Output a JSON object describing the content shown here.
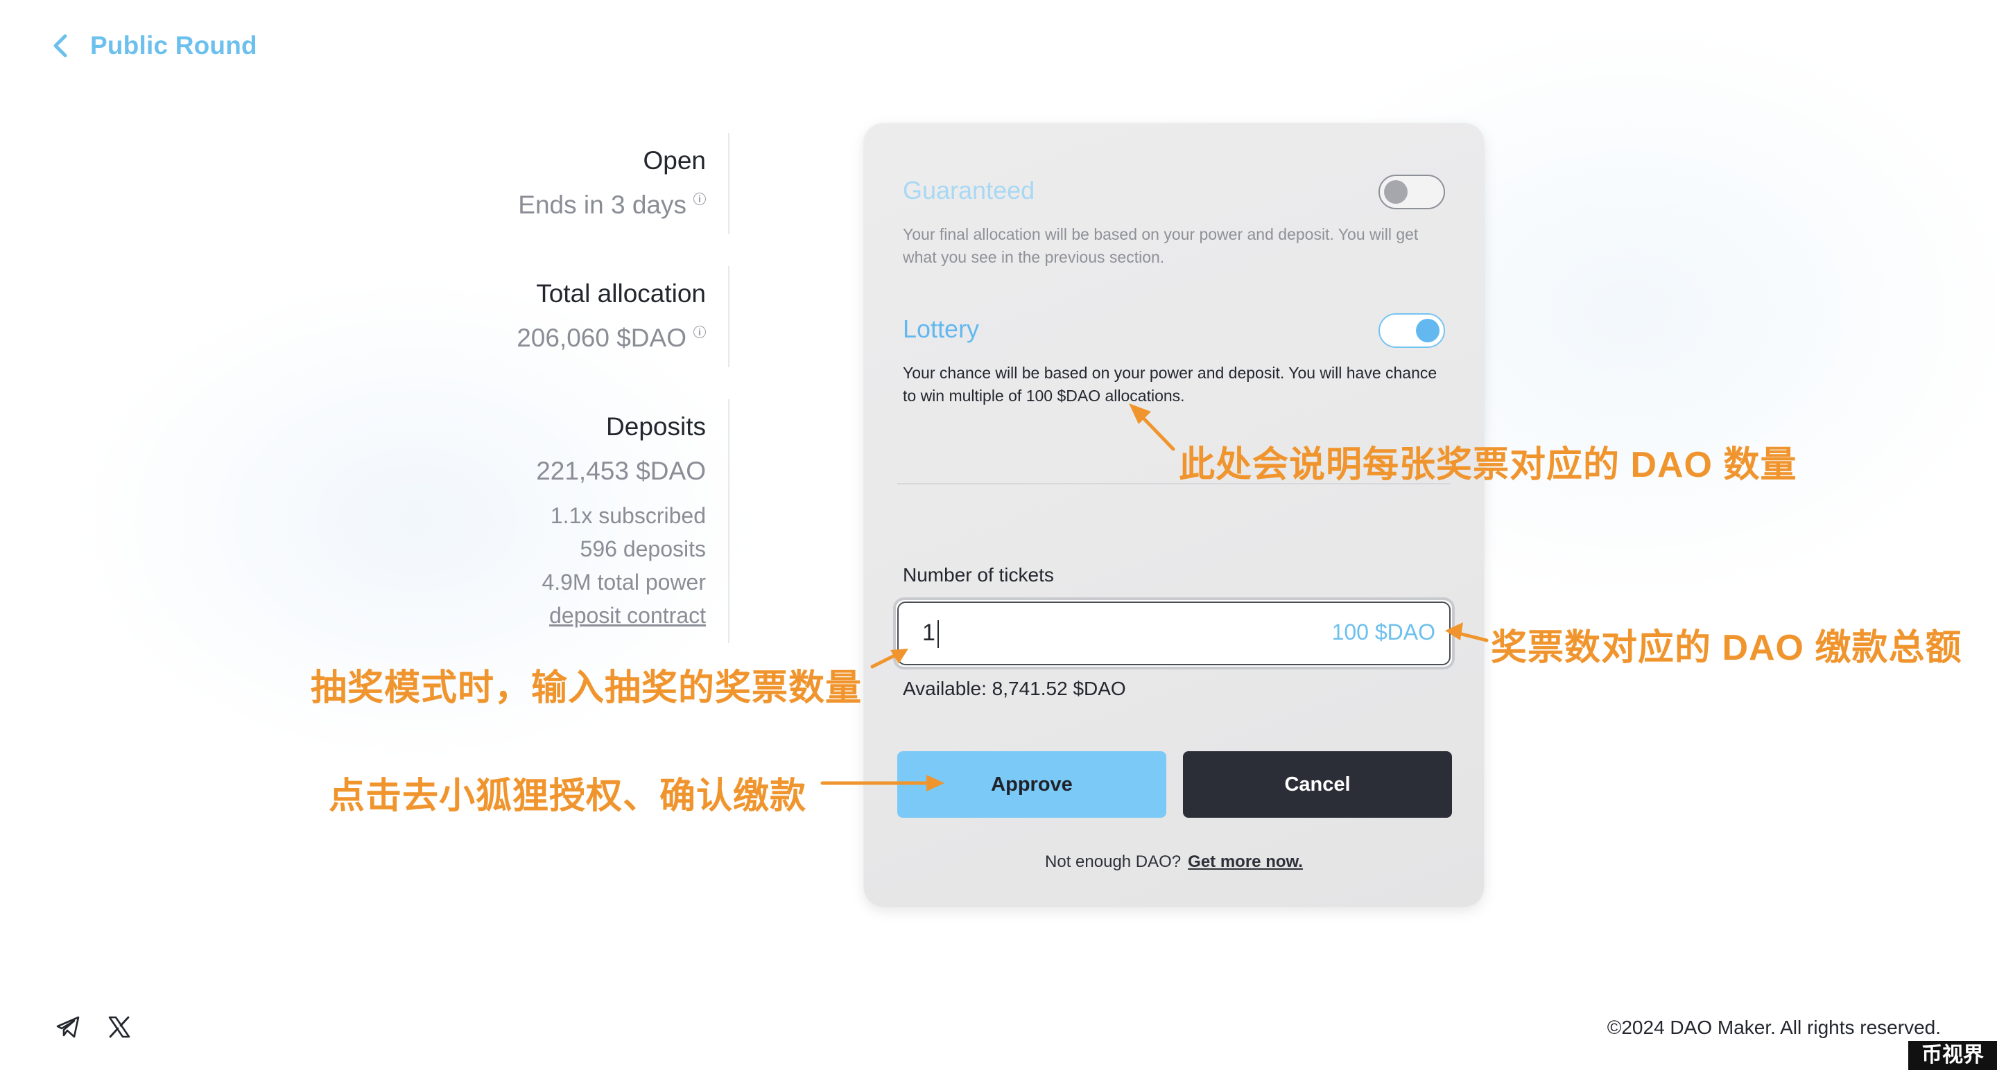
{
  "header": {
    "back_icon": "chevron-left-icon",
    "title": "Public Round"
  },
  "info": {
    "open_label": "Open",
    "ends": "Ends in 3 days",
    "total_allocation_label": "Total allocation",
    "total_allocation_value": "206,060 $DAO",
    "deposits_label": "Deposits",
    "deposits_value": "221,453 $DAO",
    "subscribed": "1.1x subscribed",
    "deposit_count": "596 deposits",
    "total_power": "4.9M total power",
    "deposit_contract_link": "deposit contract",
    "info_icon_glyph": "i"
  },
  "card": {
    "guaranteed": {
      "title": "Guaranteed",
      "enabled": false,
      "description": "Your final allocation will be based on your power and deposit. You will get what you see in the previous section."
    },
    "lottery": {
      "title": "Lottery",
      "enabled": true,
      "description": "Your chance will be based on your power and deposit. You will have chance to win multiple of 100 $DAO allocations."
    },
    "tickets_label": "Number of tickets",
    "tickets_value": "1",
    "tickets_suffix": "100 $DAO",
    "available": "Available: 8,741.52 $DAO",
    "approve_label": "Approve",
    "cancel_label": "Cancel",
    "not_enough": "Not enough DAO?",
    "get_more": "Get more now."
  },
  "annotations": {
    "ticket_note": "此处会说明每张奖票对应的 DAO 数量",
    "total_note": "奖票数对应的 DAO 缴款总额",
    "input_note": "抽奖模式时，输入抽奖的奖票数量",
    "approve_note": "点击去小狐狸授权、确认缴款",
    "color": "#f0952e"
  },
  "footer": {
    "telegram_icon": "telegram-icon",
    "x_icon": "x-twitter-icon",
    "copyright": "©2024 DAO Maker. All rights reserved.",
    "watermark": "币视界"
  },
  "colors": {
    "accent": "#6cc0ee",
    "approve": "#7ac9f7",
    "cancel": "#2b2e36"
  }
}
